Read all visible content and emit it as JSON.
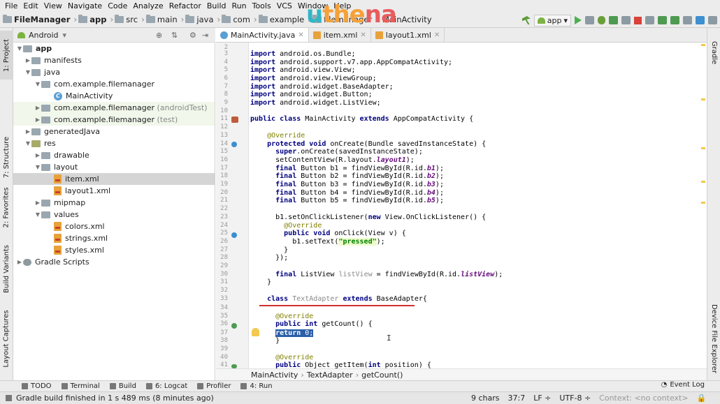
{
  "menu": [
    "File",
    "Edit",
    "View",
    "Navigate",
    "Code",
    "Analyze",
    "Refactor",
    "Build",
    "Run",
    "Tools",
    "VCS",
    "Window",
    "Help"
  ],
  "breadcrumb": [
    "FileManager",
    "app",
    "src",
    "main",
    "java",
    "com",
    "example",
    "filemanager",
    "MainActivity"
  ],
  "logo_text": {
    "a": "u",
    "b": "the",
    "c": "na"
  },
  "run_config": "app",
  "left_tool_tabs": [
    "1: Project",
    "7: Structure",
    "2: Favorites",
    "Build Variants",
    "Layout Captures"
  ],
  "right_tool_tabs": [
    "Gradle",
    "Device File Explorer"
  ],
  "project_view": "Android",
  "tree": [
    {
      "label": "app",
      "suffix": ""
    },
    {
      "label": "manifests",
      "suffix": ""
    },
    {
      "label": "java",
      "suffix": ""
    },
    {
      "label": "com.example.filemanager",
      "suffix": ""
    },
    {
      "label": "MainActivity",
      "suffix": ""
    },
    {
      "label": "com.example.filemanager",
      "suffix": "(androidTest)"
    },
    {
      "label": "com.example.filemanager",
      "suffix": "(test)"
    },
    {
      "label": "generatedJava",
      "suffix": ""
    },
    {
      "label": "res",
      "suffix": ""
    },
    {
      "label": "drawable",
      "suffix": ""
    },
    {
      "label": "layout",
      "suffix": ""
    },
    {
      "label": "item.xml",
      "suffix": ""
    },
    {
      "label": "layout1.xml",
      "suffix": ""
    },
    {
      "label": "mipmap",
      "suffix": ""
    },
    {
      "label": "values",
      "suffix": ""
    },
    {
      "label": "colors.xml",
      "suffix": ""
    },
    {
      "label": "strings.xml",
      "suffix": ""
    },
    {
      "label": "styles.xml",
      "suffix": ""
    },
    {
      "label": "Gradle Scripts",
      "suffix": ""
    }
  ],
  "editor_tabs": [
    "MainActivity.java",
    "item.xml",
    "layout1.xml"
  ],
  "line_numbers": [
    "2",
    "3",
    "4",
    "5",
    "6",
    "7",
    "8",
    "9",
    "10",
    "11",
    "12",
    "13",
    "14",
    "15",
    "16",
    "17",
    "18",
    "19",
    "20",
    "21",
    "22",
    "23",
    "24",
    "25",
    "26",
    "27",
    "28",
    "29",
    "30",
    "31",
    "32",
    "33",
    "34",
    "35",
    "36",
    "37",
    "38",
    "39",
    "40",
    "41"
  ],
  "code": {
    "l2": "",
    "l3a": "import",
    "l3b": " android.os.Bundle;",
    "l4a": "import",
    "l4b": " android.support.v7.app.AppCompatActivity;",
    "l5a": "import",
    "l5b": " android.view.View;",
    "l6a": "import",
    "l6b": " android.view.ViewGroup;",
    "l7a": "import",
    "l7b": " android.widget.BaseAdapter;",
    "l8a": "import",
    "l8b": " android.widget.Button;",
    "l9a": "import",
    "l9b": " android.widget.ListView;",
    "l11a": "public class",
    "l11b": " MainActivity ",
    "l11c": "extends",
    "l11d": " AppCompatActivity {",
    "l13": "    @Override",
    "l14a": "    protected void",
    "l14b": " onCreate(Bundle savedInstanceState) {",
    "l15a": "      super",
    "l15b": ".onCreate(savedInstanceState);",
    "l16a": "      setContentView(R.layout.",
    "l16b": "layout1",
    "l16c": ");",
    "l17a": "      final",
    "l17b": " Button b1 = findViewById(R.id.",
    "l17c": "b1",
    "l17d": ");",
    "l18a": "      final",
    "l18b": " Button b2 = findViewById(R.id.",
    "l18c": "b2",
    "l18d": ");",
    "l19a": "      final",
    "l19b": " Button b3 = findViewById(R.id.",
    "l19c": "b3",
    "l19d": ");",
    "l20a": "      final",
    "l20b": " Button b4 = findViewById(R.id.",
    "l20c": "b4",
    "l20d": ");",
    "l21a": "      final",
    "l21b": " Button b5 = findViewById(R.id.",
    "l21c": "b5",
    "l21d": ");",
    "l23a": "      b1.setOnClickListener(",
    "l23b": "new",
    "l23c": " View.OnClickListener() {",
    "l24": "        @Override",
    "l25a": "        public void",
    "l25b": " onClick(View v) {",
    "l26a": "          b1.setText(",
    "l26b": "\"pressed\"",
    "l26c": ");",
    "l27": "        }",
    "l28": "      });",
    "l30a": "      final",
    "l30b": " ListView ",
    "l30c": "listView",
    "l30d": " = findViewById(R.id.",
    "l30e": "listView",
    "l30f": ");",
    "l31": "    }",
    "l33a": "    class",
    "l33b": " TextAdapter ",
    "l33c": "extends",
    "l33d": " BaseAdapter{",
    "l35": "      @Override",
    "l36a": "      public int",
    "l36b": " getCount() {",
    "l37a": "return",
    "l37b": " 0;",
    "l38": "      }",
    "l40": "      @Override",
    "l41a": "      public",
    "l41b": " Object getItem(",
    "l41c": "int",
    "l41d": " position) {"
  },
  "editor_breadcrumb": [
    "MainActivity",
    "TextAdapter",
    "getCount()"
  ],
  "tool_windows": [
    "TODO",
    "Terminal",
    "Build",
    "6: Logcat",
    "Profiler",
    "4: Run"
  ],
  "event_log": "Event Log",
  "status": {
    "message": "Gradle build finished in 1 s 489 ms (8 minutes ago)",
    "chars": "9 chars",
    "position": "37:7",
    "line_sep": "LF ÷",
    "encoding": "UTF-8 ÷",
    "context": "Context: <no context>"
  },
  "colors": {
    "accent": "#2a5fa8",
    "keyword": "#000080",
    "annotation": "#808000",
    "string": "#008000",
    "field": "#660e7a",
    "underline": "#d32f2f"
  }
}
